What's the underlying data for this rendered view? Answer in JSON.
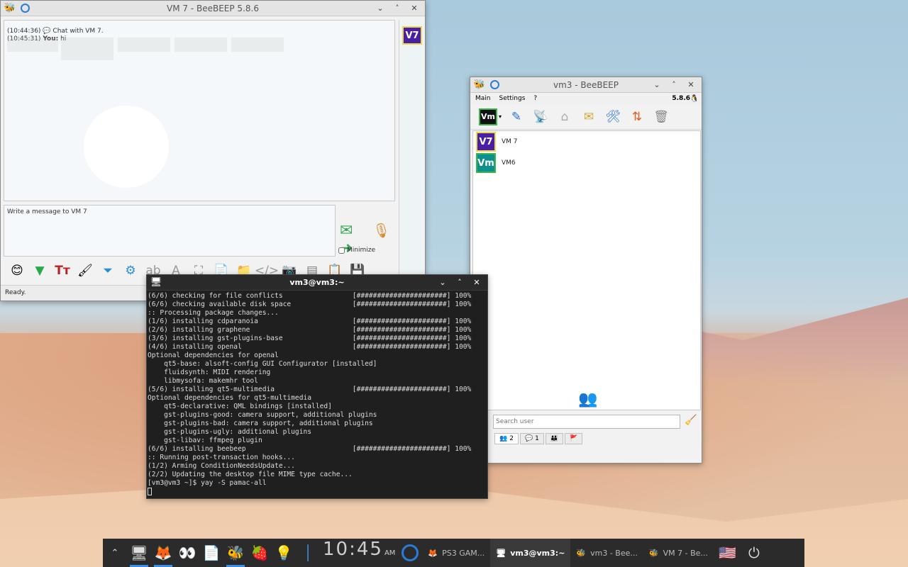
{
  "chat_window": {
    "title": "VM 7 - BeeBEEP 5.8.6",
    "messages": [
      {
        "time": "(10:44:36)",
        "text": "Chat with VM 7."
      },
      {
        "time": "(10:45:31)",
        "sender": "You:",
        "text": "hi"
      }
    ],
    "avatar": "V7",
    "compose_placeholder": "Write a message to VM 7",
    "minimize_label": "Minimize",
    "status": "Ready."
  },
  "vm3_window": {
    "title": "vm3 - BeeBEEP",
    "menu": [
      "Main",
      "Settings",
      "?"
    ],
    "version": "5.8.6",
    "me_avatar": "Vm",
    "users": [
      {
        "avatar": "V7",
        "name": "VM 7",
        "color": "#4b1fa5"
      },
      {
        "avatar": "Vm",
        "name": "VM6",
        "color": "#0d8f8f"
      }
    ],
    "search_placeholder": "Search user",
    "tabs": [
      {
        "icon": "users-icon",
        "count": "2"
      },
      {
        "icon": "chat-icon",
        "count": "1"
      },
      {
        "icon": "group-icon",
        "count": ""
      },
      {
        "icon": "flag-icon",
        "count": ""
      }
    ]
  },
  "terminal": {
    "title": "vm3@vm3:~",
    "lines": [
      "(6/6) checking for file conflicts                 [######################] 100%",
      "(6/6) checking available disk space               [######################] 100%",
      ":: Processing package changes...",
      "(1/6) installing cdparanoia                       [######################] 100%",
      "(2/6) installing graphene                         [######################] 100%",
      "(3/6) installing gst-plugins-base                 [######################] 100%",
      "(4/6) installing openal                           [######################] 100%",
      "Optional dependencies for openal",
      "    qt5-base: alsoft-config GUI Configurator [installed]",
      "    fluidsynth: MIDI rendering",
      "    libmysofa: makemhr tool",
      "(5/6) installing qt5-multimedia                   [######################] 100%",
      "Optional dependencies for qt5-multimedia",
      "    qt5-declarative: QML bindings [installed]",
      "    gst-plugins-good: camera support, additional plugins",
      "    gst-plugins-bad: camera support, additional plugins",
      "    gst-plugins-ugly: additional plugins",
      "    gst-libav: ffmpeg plugin",
      "(6/6) installing beebeep                          [######################] 100%",
      ":: Running post-transaction hooks...",
      "(1/2) Arming ConditionNeedsUpdate...",
      "(2/2) Updating the desktop file MIME type cache...",
      "[vm3@vm3 ~]$ yay -S pamac-all"
    ]
  },
  "taskbar": {
    "clock": "10:45",
    "ampm": "AM",
    "tasks": [
      {
        "label": "PS3 GAM...",
        "icon": "firefox-icon"
      },
      {
        "label": "vm3@vm3:~",
        "icon": "terminal-icon"
      },
      {
        "label": "vm3 - Bee...",
        "icon": "beebeep-icon"
      },
      {
        "label": "VM 7 - Be...",
        "icon": "beebeep-icon"
      }
    ]
  }
}
